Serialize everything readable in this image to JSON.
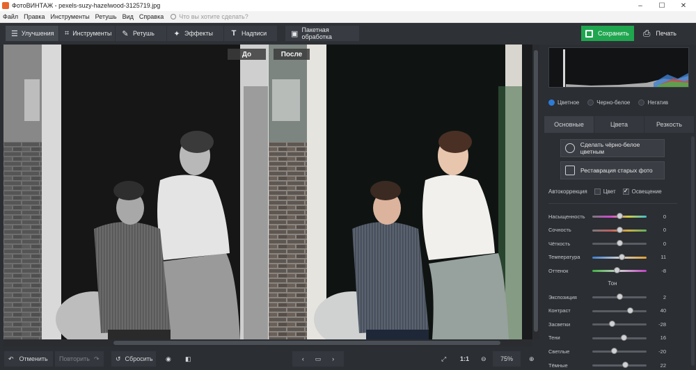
{
  "window": {
    "title": "ФотоВИНТАЖ - pexels-suzy-hazelwood-3125719.jpg",
    "controls": [
      "–",
      "☐",
      "✕"
    ]
  },
  "menu": {
    "items": [
      "Файл",
      "Правка",
      "Инструменты",
      "Ретушь",
      "Вид",
      "Справка"
    ],
    "search_placeholder": "Что вы хотите сделать?"
  },
  "toolbar": {
    "tabs": [
      {
        "label": "Улучшения",
        "icon": "sliders-icon"
      },
      {
        "label": "Инструменты",
        "icon": "crop-icon"
      },
      {
        "label": "Ретушь",
        "icon": "brush-icon"
      },
      {
        "label": "Эффекты",
        "icon": "magic-wand-icon"
      },
      {
        "label": "Надписи",
        "icon": "text-icon"
      },
      {
        "label": "Пакетная обработка",
        "icon": "images-icon"
      }
    ],
    "save_label": "Сохранить",
    "print_label": "Печать"
  },
  "canvas": {
    "before_label": "До",
    "after_label": "После"
  },
  "bottom": {
    "undo_label": "Отменить",
    "redo_label": "Повторить",
    "reset_label": "Сбросить",
    "ratio_label": "1:1",
    "zoom_value": "75%"
  },
  "panel": {
    "modes": [
      {
        "label": "Цветное",
        "selected": true
      },
      {
        "label": "Черно-белое",
        "selected": false
      },
      {
        "label": "Негатив",
        "selected": false
      }
    ],
    "tabs": [
      "Основные",
      "Цвета",
      "Резкость"
    ],
    "colorize_button": "Сделать чёрно-белое цветным",
    "restore_button": "Реставрация старых фото",
    "autocorrection": {
      "label": "Автокоррекция",
      "color_label": "Цвет",
      "color_checked": false,
      "light_label": "Освещение",
      "light_checked": true
    },
    "sliders_color": [
      {
        "label": "Насыщенность",
        "value": "0",
        "level": 0.5
      },
      {
        "label": "Сочность",
        "value": "0",
        "level": 0.5
      },
      {
        "label": "Чёткость",
        "value": "0",
        "level": 0.5
      },
      {
        "label": "Температура",
        "value": "11",
        "level": 0.55
      },
      {
        "label": "Оттенок",
        "value": "-8",
        "level": 0.46
      }
    ],
    "tone_title": "Тон",
    "sliders_tone": [
      {
        "label": "Экспозиция",
        "value": "2",
        "level": 0.51
      },
      {
        "label": "Контраст",
        "value": "40",
        "level": 0.7
      },
      {
        "label": "Засветки",
        "value": "-28",
        "level": 0.36
      },
      {
        "label": "Тени",
        "value": "16",
        "level": 0.58
      },
      {
        "label": "Светлые",
        "value": "-20",
        "level": 0.4
      },
      {
        "label": "Тёмные",
        "value": "22",
        "level": 0.61
      }
    ],
    "colors": {
      "accent": "#2e7bd6",
      "save": "#1fa64f"
    }
  }
}
